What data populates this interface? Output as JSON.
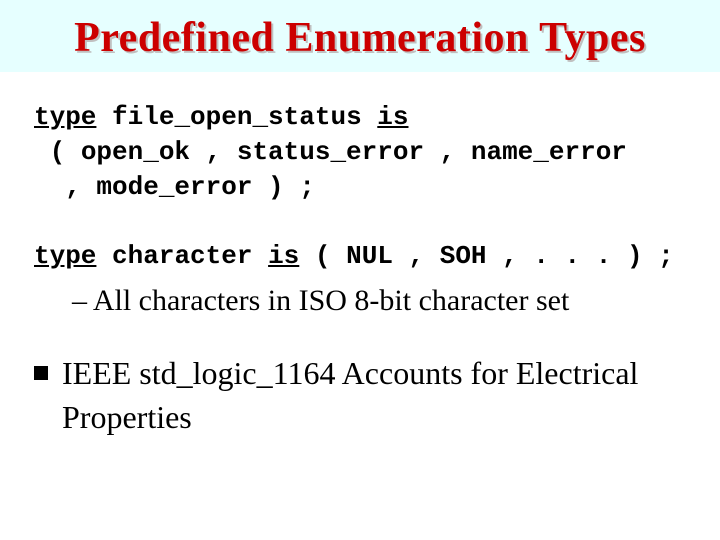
{
  "title": "Predefined Enumeration Types",
  "code1": {
    "kw_type": "type",
    "name": "file_open_status",
    "kw_is": "is",
    "line2": "( open_ok , status_error , name_error",
    "line3": ", mode_error ) ;"
  },
  "code2": {
    "kw_type": "type",
    "name": "character",
    "kw_is": "is",
    "rest": "( NUL , SOH , . . . ) ;"
  },
  "sub_bullet": "– All characters in ISO 8-bit character set",
  "main_bullet": "IEEE std_logic_1164 Accounts for Electrical Properties"
}
